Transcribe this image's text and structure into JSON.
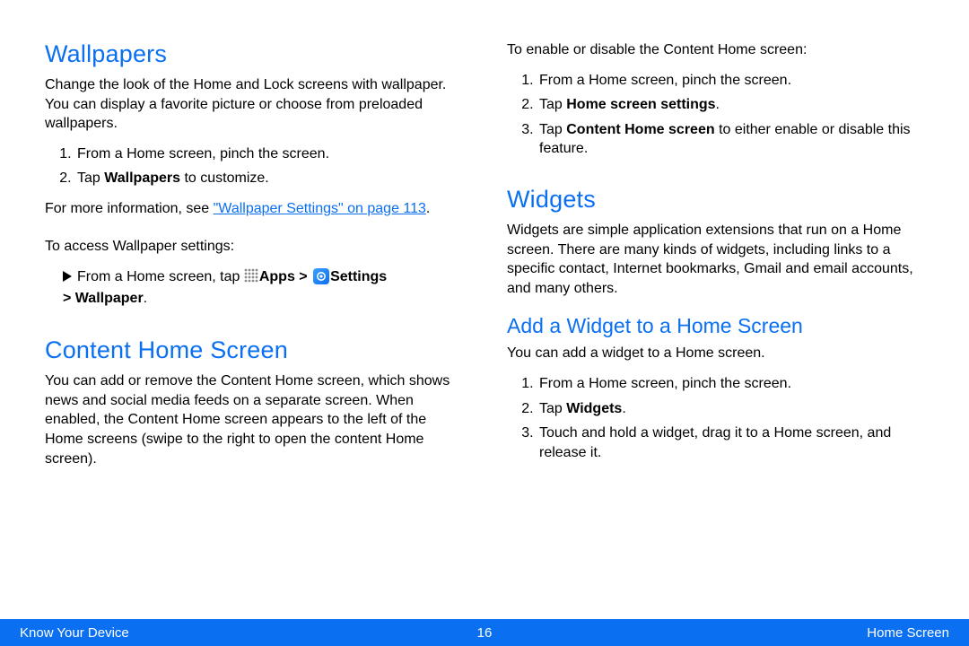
{
  "left": {
    "h_wallpapers": "Wallpapers",
    "wallpapers_intro": "Change the look of the Home and Lock screens with wallpaper. You can display a favorite picture or choose from preloaded wallpapers.",
    "wallpapers_steps": {
      "s1": "From a Home screen, pinch the screen.",
      "s2a": "Tap ",
      "s2b": "Wallpapers",
      "s2c": " to customize."
    },
    "more_info_a": "For more information, see ",
    "more_info_link": "\"Wallpaper Settings\" on page 113",
    "more_info_c": ".",
    "access_intro": "To access Wallpaper settings:",
    "access_line_a": "From a Home screen, tap ",
    "access_apps": "Apps",
    "access_gt": " > ",
    "access_settings": "Settings",
    "access_line_b": " > ",
    "access_wallpaper": "Wallpaper",
    "access_line_c": ".",
    "h_content": "Content Home Screen",
    "content_intro": "You can add or remove the Content Home screen, which shows news and social media feeds on a separate screen. When enabled, the Content Home screen appears to the left of the Home screens (swipe to the right to open the content Home screen)."
  },
  "right": {
    "enable_intro": "To enable or disable the Content Home screen:",
    "enable_steps": {
      "s1": "From a Home screen, pinch the screen.",
      "s2a": "Tap ",
      "s2b": "Home screen settings",
      "s2c": ".",
      "s3a": "Tap ",
      "s3b": "Content Home screen",
      "s3c": " to either enable or disable this feature."
    },
    "h_widgets": "Widgets",
    "widgets_intro": "Widgets are simple application extensions that run on a Home screen. There are many kinds of widgets, including links to a specific contact, Internet bookmarks, Gmail and email accounts, and many others.",
    "h_add": "Add a Widget to a Home Screen",
    "add_intro": "You can add a widget to a Home screen.",
    "add_steps": {
      "s1": "From a Home screen, pinch the screen.",
      "s2a": "Tap ",
      "s2b": "Widgets",
      "s2c": ".",
      "s3": "Touch and hold a widget, drag it to a Home screen, and release it."
    }
  },
  "footer": {
    "left": "Know Your Device",
    "center": "16",
    "right": "Home Screen"
  }
}
